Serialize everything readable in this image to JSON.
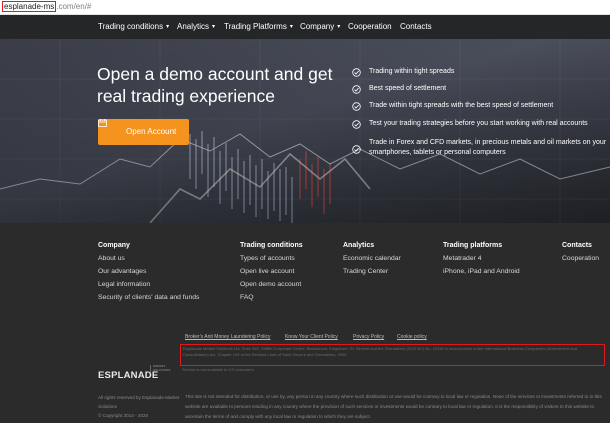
{
  "browser": {
    "url_host": "esplanade-ms",
    "url_path": ".com/en/#"
  },
  "nav": {
    "items": [
      {
        "label": "Trading conditions",
        "has_dropdown": true
      },
      {
        "label": "Analytics",
        "has_dropdown": true
      },
      {
        "label": "Trading Platforms",
        "has_dropdown": true
      },
      {
        "label": "Company",
        "has_dropdown": true
      },
      {
        "label": "Cooperation",
        "has_dropdown": false
      },
      {
        "label": "Contacts",
        "has_dropdown": false
      }
    ],
    "caret": "▾"
  },
  "hero": {
    "title": "Open a demo account and get real trading experience",
    "button_label": "Open Account",
    "features": [
      "Trading within tight spreads",
      "Best speed of settlement",
      "Trade within tight spreads with the best speed of settlement",
      "Test your trading strategies before you start working with real accounts",
      "Trade in Forex and CFD markets, in precious metals and oil markets on your smartphones, tablets or personal computers"
    ]
  },
  "footer": {
    "columns": [
      {
        "heading": "Company",
        "links": [
          "About us",
          "Our advantages",
          "Legal information",
          "Security of clients' data and funds"
        ]
      },
      {
        "heading": "Trading conditions",
        "links": [
          "Types of accounts",
          "Open live account",
          "Open demo account",
          "FAQ"
        ]
      },
      {
        "heading": "Analytics",
        "links": [
          "Economic calendar",
          "Trading Center"
        ]
      },
      {
        "heading": "Trading platforms",
        "links": [
          "Metatrader 4",
          "iPhone, iPad and Android"
        ]
      },
      {
        "heading": "Contacts",
        "links": [
          "Cooperation"
        ]
      }
    ],
    "policies": [
      "Broker's Anti Money Laundering Policy",
      "Know Your Client Policy",
      "Privacy Policy",
      "Cookie policy"
    ],
    "disclaimer": "Esplanade Market Solutions Ltd. Suite 305, Griffith Corporate Centre, Beachmont, Kingstown, St. Vincent and the Grenadines (SVG BC) No. 23116 in incorporation under International Business Companies (Amendment and Consolidation) Act, Chapter 149 of the Revised Laws of Saint Vincent and Grenadines, 2009.",
    "disclaimer_extra": "Service is not available to US customers.",
    "logo": "ESPLANADE",
    "logo_sub": "MARKET SOLUTIONS",
    "rights": [
      "All rights reserved by Esplanade Market Solutions",
      "© Copyright 2014 - 2020"
    ],
    "legal": "This site is not intended for distribution, or use by, any person in any country where such distribution or use would be contrary to local law or regulation. None of the services or investments referred to in this website are available to persons residing in any country where the provision of such services or investments would be contrary to local law or regulation. It is the responsibility of visitors to this website to ascertain the terms of and comply with any local law or regulation to which they are subject."
  },
  "colors": {
    "accent": "#f5931f",
    "highlight_box": "#e0191a",
    "nav_bg": "#252628",
    "footer_bg": "#2b2b2b"
  },
  "icons": {
    "button": "calendar-icon",
    "feature": "check-circle-icon"
  }
}
